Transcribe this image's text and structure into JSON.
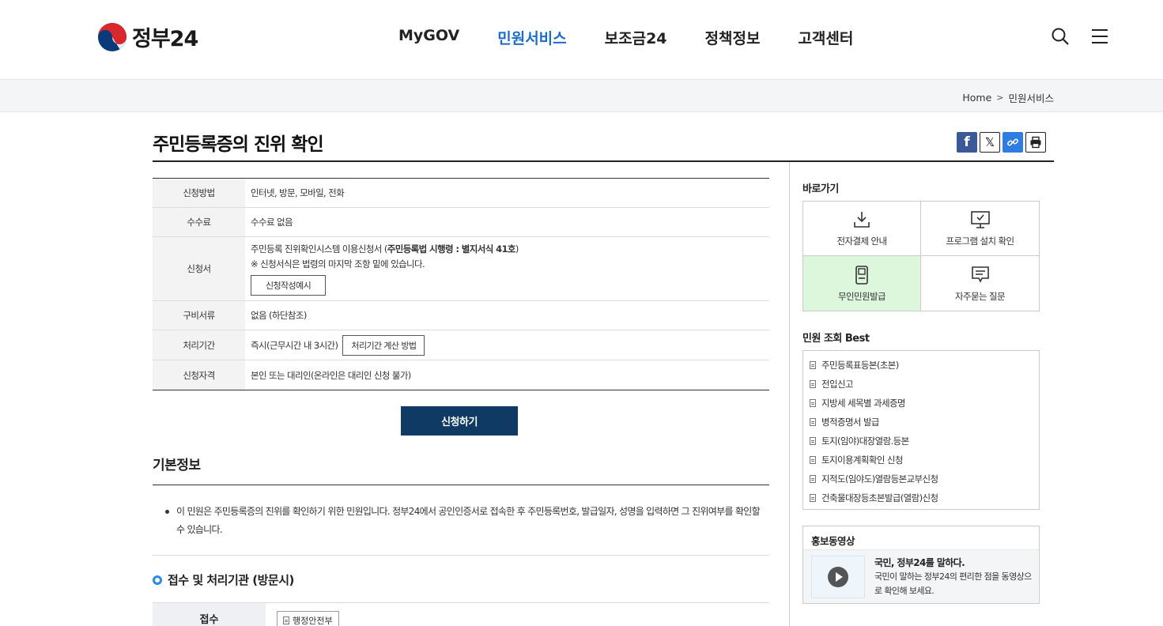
{
  "header": {
    "logo_text": "정부24",
    "nav": [
      "MyGOV",
      "민원서비스",
      "보조금24",
      "정책정보",
      "고객센터"
    ]
  },
  "breadcrumb": {
    "home": "Home",
    "current": "민원서비스"
  },
  "page": {
    "title": "주민등록증의 진위 확인"
  },
  "share": {
    "facebook": "f",
    "x": "𝕏"
  },
  "info": {
    "method_label": "신청방법",
    "method_value": "인터넷, 방문, 모바일, 전화",
    "fee_label": "수수료",
    "fee_value": "수수료 없음",
    "form_label": "신청서",
    "form_line1_pre": "주민등록 진위확인시스템 이용신청서 (",
    "form_line1_bold": "주민등록법 시행령 : 별지서식 41호",
    "form_line1_post": ")",
    "form_line2": "※ 신청서식은 법령의 마지막 조항 밑에 있습니다.",
    "form_example_button": "신청작성예시",
    "docs_label": "구비서류",
    "docs_value": "없음 (하단참조)",
    "period_label": "처리기간",
    "period_value": "즉시(근무시간 내 3시간)",
    "period_button": "처리기간 계산 방법",
    "qual_label": "신청자격",
    "qual_value": "본인 또는 대리인(온라인은 대리인 신청 불가)"
  },
  "apply_button": "신청하기",
  "basic": {
    "title": "기본정보",
    "description": "이 민원은 주민등록증의 진위를 확인하기 위한 민원입니다. 정부24에서 공인인증서로 접속한 후 주민등록번호, 발급일자, 성명을 입력하면 그 진위여부를 확인할 수 있습니다."
  },
  "agency": {
    "title": "접수 및 처리기관 (방문시)",
    "receive_label": "접수",
    "receive_value": "행정안전부"
  },
  "sidebar": {
    "quick_title": "바로가기",
    "quick": [
      "전자결제 안내",
      "프로그램 설치 확인",
      "무인민원발급",
      "자주묻는 질문"
    ],
    "best_title": "민원 조회 Best",
    "best": [
      "주민등록표등본(초본)",
      "전입신고",
      "지방세 세목별 과세증명",
      "병적증명서 발급",
      "토지(임야)대장열람.등본",
      "토지이용계획확인 신청",
      "지적도(임야도)열람등본교부신청",
      "건축물대장등초본발급(열람)신청"
    ],
    "promo_title": "홍보동영상",
    "promo_headline": "국민, 정부24를 말하다.",
    "promo_desc": "국민이 말하는 정부24의 편리한 점을 동영상으로 확인해 보세요."
  }
}
